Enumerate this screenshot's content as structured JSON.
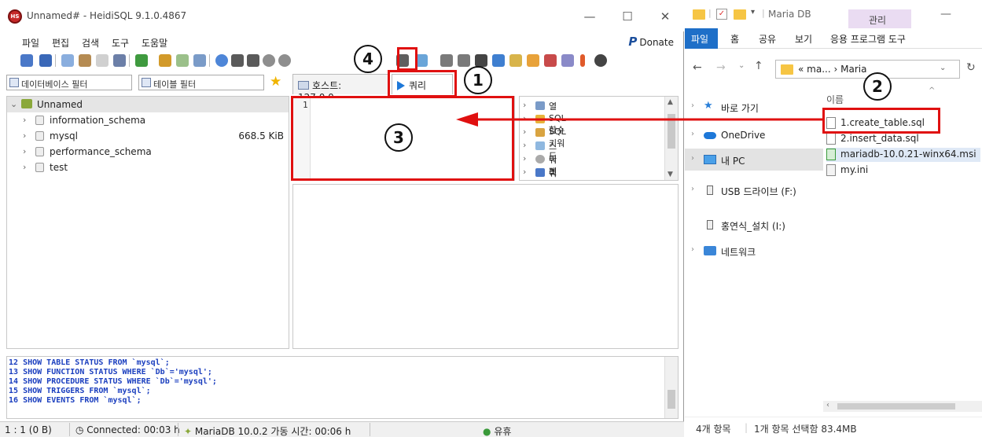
{
  "heidisql": {
    "title": "Unnamed# - HeidiSQL 9.1.0.4867",
    "app_icon": "heidisql-icon",
    "menu": [
      "파일",
      "편집",
      "검색",
      "도구",
      "도움말"
    ],
    "donate_label": "Donate",
    "filters": {
      "database_filter_placeholder": "데이터베이스 필터",
      "table_filter_placeholder": "테이블 필터"
    },
    "tree": {
      "root": "Unnamed",
      "databases": [
        {
          "name": "information_schema",
          "size": ""
        },
        {
          "name": "mysql",
          "size": "668.5 KiB"
        },
        {
          "name": "performance_schema",
          "size": ""
        },
        {
          "name": "test",
          "size": ""
        }
      ]
    },
    "tabs": {
      "host": "호스트: 127.0.0.",
      "query": "쿼리"
    },
    "editor": {
      "line_number": "1",
      "content": ""
    },
    "helper": [
      "열",
      "SQL 함수",
      "SQL 키워드",
      "스니펫",
      "쿼리 내역",
      "쿼리 프로필"
    ],
    "log": [
      {
        "num": "12",
        "text": "SHOW TABLE STATUS FROM `mysql`;"
      },
      {
        "num": "13",
        "text": "SHOW FUNCTION STATUS WHERE `Db`='mysql';"
      },
      {
        "num": "14",
        "text": "SHOW PROCEDURE STATUS WHERE `Db`='mysql';"
      },
      {
        "num": "15",
        "text": "SHOW TRIGGERS FROM `mysql`;"
      },
      {
        "num": "16",
        "text": "SHOW EVENTS FROM `mysql`;"
      }
    ],
    "status": {
      "position": "1 : 1 (0 B)",
      "connected": "Connected: 00:03 h",
      "server": "MariaDB 10.0.2 가동 시간: 00:06 h",
      "state": "유휴"
    }
  },
  "explorer": {
    "title": "Maria DB",
    "manage_tab": "관리",
    "ribbon_tabs": [
      "파일",
      "홈",
      "공유",
      "보기",
      "응용 프로그램 도구"
    ],
    "address": {
      "prefix": "«",
      "parts": [
        "ma...",
        "Maria"
      ]
    },
    "column_header": "이름",
    "nav": [
      "바로 가기",
      "OneDrive",
      "내 PC",
      "USB 드라이브 (F:)",
      "홍연식_설치 (I:)",
      "네트워크"
    ],
    "files": [
      "1.create_table.sql",
      "2.insert_data.sql",
      "mariadb-10.0.21-winx64.msi",
      "my.ini"
    ],
    "status": {
      "count": "4개 항목",
      "selection": "1개 항목 선택함 83.4MB"
    }
  },
  "annotations": {
    "callouts": [
      "1",
      "2",
      "3",
      "4"
    ],
    "arrow_color": "#e01010",
    "box_color": "#e01010"
  }
}
